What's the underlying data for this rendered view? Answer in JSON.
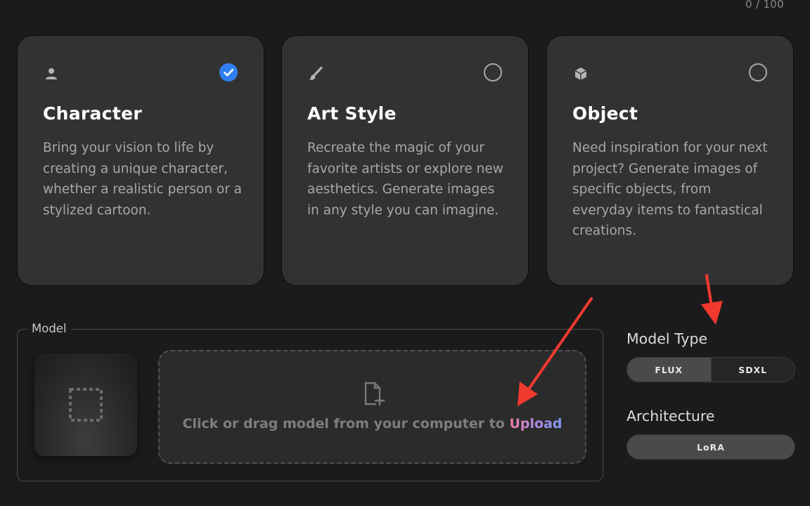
{
  "counter": "0 / 100",
  "cards": [
    {
      "icon": "person-icon",
      "title": "Character",
      "description": "Bring your vision to life by creating a unique character, whether a realistic person or a stylized cartoon.",
      "selected": true
    },
    {
      "icon": "paintbrush-icon",
      "title": "Art Style",
      "description": "Recreate the magic of your favorite artists or explore new aesthetics. Generate images in any style you can imagine.",
      "selected": false
    },
    {
      "icon": "cube-icon",
      "title": "Object",
      "description": "Need inspiration for your next project? Generate images of specific objects, from everyday items to fantastical creations.",
      "selected": false
    }
  ],
  "model": {
    "legend": "Model",
    "thumbnail_icon": "image-placeholder-icon",
    "dropzone_icon": "file-add-icon",
    "dropzone_text": "Click or drag model from your computer to",
    "upload_link": "Upload"
  },
  "model_type": {
    "label": "Model Type",
    "options": [
      "FLUX",
      "SDXL"
    ],
    "selected": "FLUX"
  },
  "architecture": {
    "label": "Architecture",
    "value": "LoRA"
  },
  "colors": {
    "accent": "#2f7ff0",
    "annotation_arrow": "#f03a30",
    "upload_gradient": [
      "#f07aa8",
      "#7d9af3"
    ]
  }
}
